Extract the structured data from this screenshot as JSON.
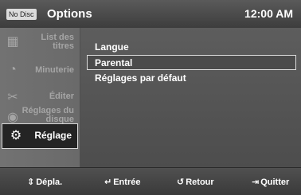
{
  "header": {
    "status_badge": "No Disc",
    "title": "Options",
    "clock": "12:00 AM"
  },
  "sidebar": {
    "items": [
      {
        "label": "List des titres",
        "icon": "film-icon"
      },
      {
        "label": "Minuterie",
        "icon": "timer-icon"
      },
      {
        "label": "Éditer",
        "icon": "scissors-icon"
      },
      {
        "label": "Réglages du disque",
        "icon": "disc-icon"
      },
      {
        "label": "Réglage",
        "icon": "gear-icon"
      }
    ]
  },
  "main": {
    "items": [
      "Langue",
      "Parental",
      "Réglages par défaut"
    ],
    "selected": "Parental"
  },
  "footer": {
    "hints": [
      {
        "label": "Dépla.",
        "icon": "up-down-arrows-icon"
      },
      {
        "label": "Entrée",
        "icon": "enter-icon"
      },
      {
        "label": "Retour",
        "icon": "return-icon"
      },
      {
        "label": "Quitter",
        "icon": "exit-icon"
      }
    ]
  }
}
